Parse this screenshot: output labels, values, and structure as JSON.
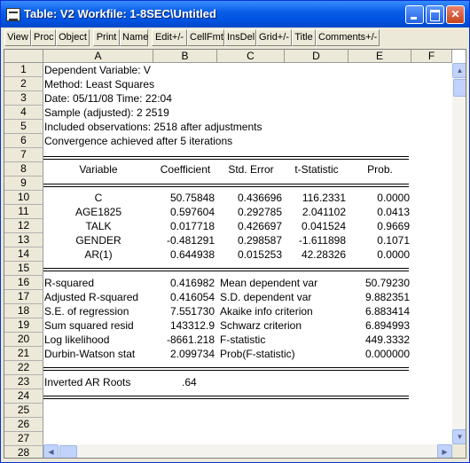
{
  "window": {
    "title": "Table: V2   Workfile: 1-8SEC\\Untitled",
    "controls": [
      "minimize",
      "maximize",
      "close"
    ]
  },
  "toolbar": {
    "buttons": [
      "View",
      "Proc",
      "Object",
      "Print",
      "Name",
      "Edit+/-",
      "CellFmt",
      "InsDel",
      "Grid+/-",
      "Title",
      "Comments+/-"
    ]
  },
  "columns": [
    "A",
    "B",
    "C",
    "D",
    "E",
    "F"
  ],
  "rows": [
    "1",
    "2",
    "3",
    "4",
    "5",
    "6",
    "7",
    "8",
    "9",
    "10",
    "11",
    "12",
    "13",
    "14",
    "15",
    "16",
    "17",
    "18",
    "19",
    "20",
    "21",
    "22",
    "23",
    "24",
    "25",
    "26",
    "27",
    "28"
  ],
  "header_info": [
    "Dependent Variable: V",
    "Method: Least Squares",
    "Date: 05/11/08   Time: 22:04",
    "Sample (adjusted): 2 2519",
    "Included observations: 2518 after adjustments",
    "Convergence achieved after 5 iterations"
  ],
  "coef_table": {
    "headers": [
      "Variable",
      "Coefficient",
      "Std. Error",
      "t-Statistic",
      "Prob."
    ],
    "rows": [
      [
        "C",
        "50.75848",
        "0.436696",
        "116.2331",
        "0.0000"
      ],
      [
        "AGE1825",
        "0.597604",
        "0.292785",
        "2.041102",
        "0.0413"
      ],
      [
        "TALK",
        "0.017718",
        "0.426697",
        "0.041524",
        "0.9669"
      ],
      [
        "GENDER",
        "-0.481291",
        "0.298587",
        "-1.611898",
        "0.1071"
      ],
      [
        "AR(1)",
        "0.644938",
        "0.015253",
        "42.28326",
        "0.0000"
      ]
    ]
  },
  "stats": [
    [
      "R-squared",
      "0.416982",
      "Mean dependent var",
      "50.79230"
    ],
    [
      "Adjusted R-squared",
      "0.416054",
      "S.D. dependent var",
      "9.882351"
    ],
    [
      "S.E. of regression",
      "7.551730",
      "Akaike info criterion",
      "6.883414"
    ],
    [
      "Sum squared resid",
      "143312.9",
      "Schwarz criterion",
      "6.894993"
    ],
    [
      "Log likelihood",
      "-8661.218",
      "F-statistic",
      "449.3332"
    ],
    [
      "Durbin-Watson stat",
      "2.099734",
      "Prob(F-statistic)",
      "0.000000"
    ]
  ],
  "ar_roots": {
    "label": "Inverted AR Roots",
    "value": ".64"
  }
}
